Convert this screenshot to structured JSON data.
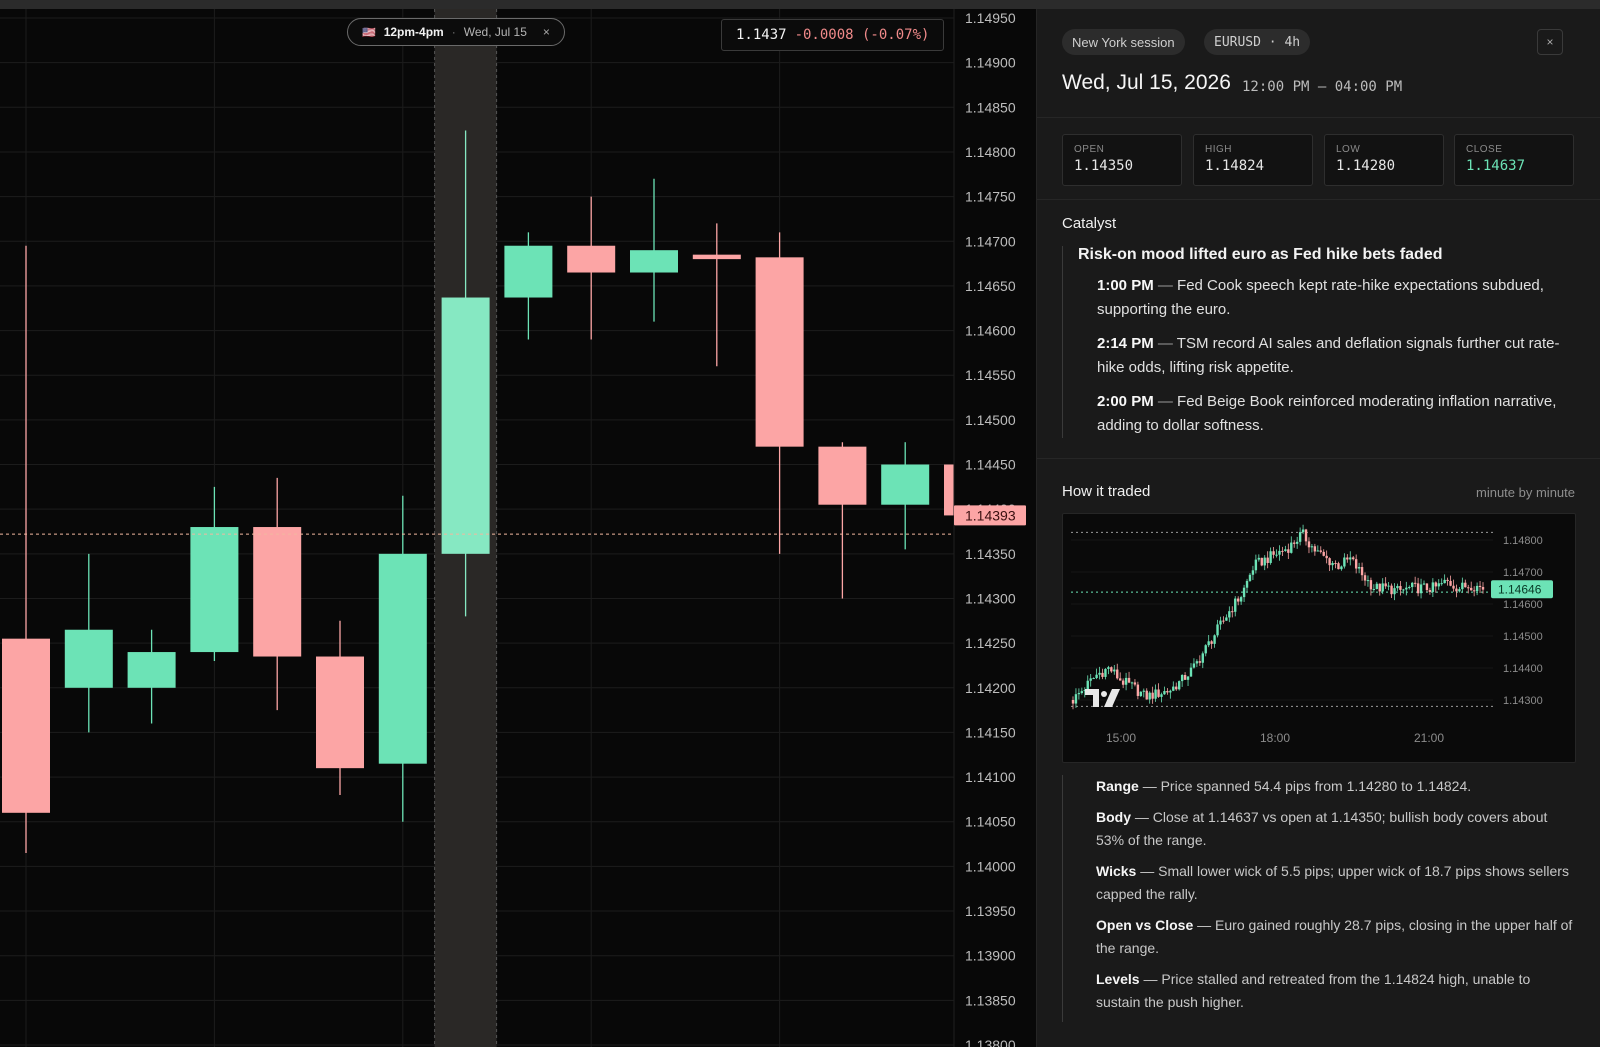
{
  "session_pill": {
    "flag": "🇺🇸",
    "time": "12pm-4pm",
    "separator": "·",
    "date": "Wed, Jul 15",
    "close": "×"
  },
  "price_readout": {
    "last": "1.1437",
    "change": "-0.0008 (-0.07%)"
  },
  "colors": {
    "up": "#6ce3b6",
    "down": "#fca5a5",
    "highlight_up": "#86e8c2",
    "background": "#080808",
    "panel": "#1a1a1a"
  },
  "chart_data": [
    {
      "type": "candlestick",
      "title": "",
      "y_ticks": [
        "1.14950",
        "1.14900",
        "1.14850",
        "1.14800",
        "1.14750",
        "1.14700",
        "1.14650",
        "1.14600",
        "1.14550",
        "1.14500",
        "1.14450",
        "1.14400",
        "1.14350",
        "1.14300",
        "1.14250",
        "1.14200",
        "1.14150",
        "1.14100",
        "1.14050",
        "1.14000",
        "1.13950",
        "1.13900",
        "1.13850",
        "1.13800"
      ],
      "ylim": [
        1.138,
        1.1495
      ],
      "last_price_label": "1.14393",
      "last_price": 1.14393,
      "reference_line": 1.14372,
      "highlighted_index": 7,
      "candles": [
        {
          "o": 1.14255,
          "h": 1.14695,
          "l": 1.14015,
          "c": 1.1406
        },
        {
          "o": 1.142,
          "h": 1.1435,
          "l": 1.1415,
          "c": 1.14265
        },
        {
          "o": 1.142,
          "h": 1.14265,
          "l": 1.1416,
          "c": 1.1424
        },
        {
          "o": 1.1424,
          "h": 1.14425,
          "l": 1.1423,
          "c": 1.1438
        },
        {
          "o": 1.1438,
          "h": 1.14435,
          "l": 1.14175,
          "c": 1.14235
        },
        {
          "o": 1.14235,
          "h": 1.14275,
          "l": 1.1408,
          "c": 1.1411
        },
        {
          "o": 1.14115,
          "h": 1.14415,
          "l": 1.1405,
          "c": 1.1435
        },
        {
          "o": 1.1435,
          "h": 1.14824,
          "l": 1.1428,
          "c": 1.14637
        },
        {
          "o": 1.14637,
          "h": 1.1471,
          "l": 1.1459,
          "c": 1.14695
        },
        {
          "o": 1.14695,
          "h": 1.1475,
          "l": 1.1459,
          "c": 1.14665
        },
        {
          "o": 1.14665,
          "h": 1.1477,
          "l": 1.1461,
          "c": 1.1469
        },
        {
          "o": 1.14685,
          "h": 1.1472,
          "l": 1.1456,
          "c": 1.1468
        },
        {
          "o": 1.14682,
          "h": 1.1471,
          "l": 1.1435,
          "c": 1.1447
        },
        {
          "o": 1.1447,
          "h": 1.14475,
          "l": 1.143,
          "c": 1.14405
        },
        {
          "o": 1.14405,
          "h": 1.14475,
          "l": 1.14355,
          "c": 1.1445
        },
        {
          "o": 1.1445,
          "h": 1.145,
          "l": 1.1438,
          "c": 1.14393
        }
      ]
    },
    {
      "type": "candlestick",
      "title": "",
      "x_ticks": [
        "15:00",
        "18:00",
        "21:00"
      ],
      "y_ticks": [
        "1.14800",
        "1.14700",
        "1.14600",
        "1.14500",
        "1.14400",
        "1.14300"
      ],
      "ylim": [
        1.1425,
        1.1485
      ],
      "last_price_label": "1.14646",
      "last_price": 1.14646,
      "reference_lines": [
        1.14824,
        1.14637,
        1.1428
      ],
      "close_path": [
        1.143,
        1.1434,
        1.1438,
        1.144,
        1.1436,
        1.1434,
        1.1431,
        1.1432,
        1.1433,
        1.1436,
        1.144,
        1.1446,
        1.1452,
        1.1458,
        1.1463,
        1.1472,
        1.1474,
        1.1476,
        1.1478,
        1.1482,
        1.1477,
        1.1474,
        1.1472,
        1.1474,
        1.1469,
        1.1465,
        1.1465,
        1.1464,
        1.1465,
        1.1465,
        1.1465,
        1.1467,
        1.1465,
        1.1466,
        1.1465
      ]
    }
  ],
  "panel": {
    "tag_session": "New York session",
    "tag_symbol": "EURUSD · 4h",
    "close": "×",
    "date": "Wed, Jul 15, 2026",
    "time_range": "12:00 PM – 04:00 PM",
    "ohlc": [
      {
        "label": "OPEN",
        "value": "1.14350"
      },
      {
        "label": "HIGH",
        "value": "1.14824"
      },
      {
        "label": "LOW",
        "value": "1.14280"
      },
      {
        "label": "CLOSE",
        "value": "1.14637"
      }
    ],
    "catalyst": {
      "title": "Catalyst",
      "headline": "Risk-on mood lifted euro as Fed hike bets faded",
      "events": [
        {
          "time": "1:00 PM",
          "text": "Fed Cook speech kept rate-hike expectations subdued, supporting the euro."
        },
        {
          "time": "2:14 PM",
          "text": "TSM record AI sales and deflation signals further cut rate-hike odds, lifting risk appetite."
        },
        {
          "time": "2:00 PM",
          "text": "Fed Beige Book reinforced moderating inflation narrative, adding to dollar softness."
        }
      ]
    },
    "traded": {
      "title": "How it traded",
      "subtitle": "minute by minute",
      "notes": [
        {
          "key": "Range",
          "text": "Price spanned 54.4 pips from 1.14280 to 1.14824."
        },
        {
          "key": "Body",
          "text": "Close at 1.14637 vs open at 1.14350; bullish body covers about 53% of the range."
        },
        {
          "key": "Wicks",
          "text": "Small lower wick of 5.5 pips; upper wick of 18.7 pips shows sellers capped the rally."
        },
        {
          "key": "Open vs Close",
          "text": "Euro gained roughly 28.7 pips, closing in the upper half of the range."
        },
        {
          "key": "Levels",
          "text": "Price stalled and retreated from the 1.14824 high, unable to sustain the push higher."
        }
      ]
    },
    "dash": "—"
  }
}
